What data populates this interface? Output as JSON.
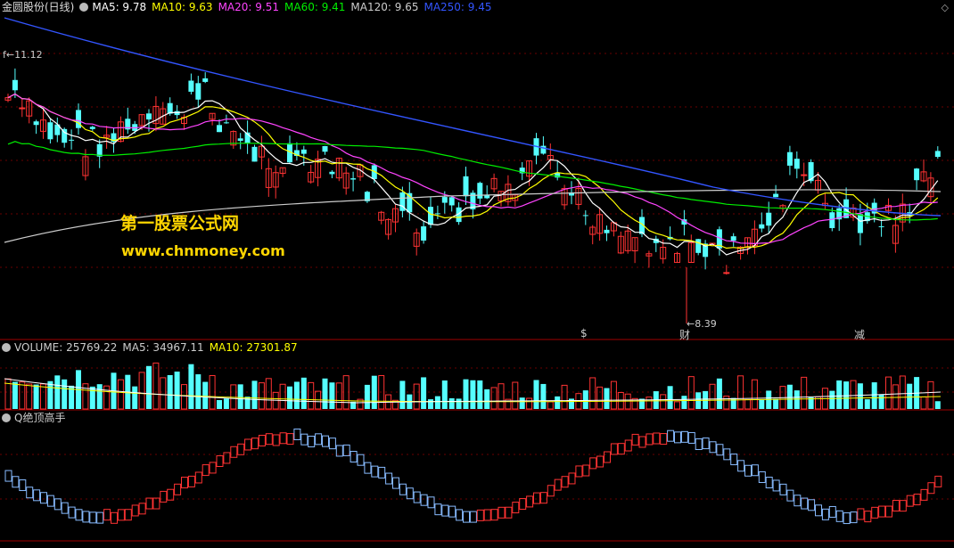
{
  "header": {
    "stock": "金圆股份(日线)",
    "ma_items": [
      {
        "text": "MA5: 9.78",
        "color": "#ffffff"
      },
      {
        "text": "MA10: 9.63",
        "color": "#ffff00"
      },
      {
        "text": "MA20: 9.51",
        "color": "#ff44ff"
      },
      {
        "text": "MA60: 9.41",
        "color": "#00ee00"
      },
      {
        "text": "MA120: 9.65",
        "color": "#cccccc"
      },
      {
        "text": "MA250: 9.45",
        "color": "#3355ff"
      }
    ]
  },
  "price_panel": {
    "high_label": "11.12",
    "low_label": "8.39",
    "markers": [
      {
        "text": "$",
        "color": "#ff3333"
      },
      {
        "text": "财",
        "color": "#5599ff"
      },
      {
        "text": "减",
        "color": "#00dd00"
      }
    ]
  },
  "watermark": {
    "line1": "第一股票公式网",
    "line2": "www.chnmoney.com"
  },
  "volume_header": {
    "items": [
      {
        "text": "VOLUME: 25769.22",
        "color": "#cccccc"
      },
      {
        "text": "MA5: 34967.11",
        "color": "#cccccc"
      },
      {
        "text": "MA10: 27301.87",
        "color": "#ffff00"
      }
    ]
  },
  "indicator_header": {
    "title": "Q绝顶高手"
  },
  "chart_data": {
    "type": "candlestick",
    "ylim": [
      8.2,
      11.6
    ],
    "ma_colors": {
      "MA5": "#ffffff",
      "MA10": "#ffff00",
      "MA20": "#ff44ff",
      "MA60": "#00ee00",
      "MA120": "#cccccc",
      "MA250": "#3355ff"
    },
    "up_color": "#ff3333",
    "down_color": "#55ffff"
  }
}
